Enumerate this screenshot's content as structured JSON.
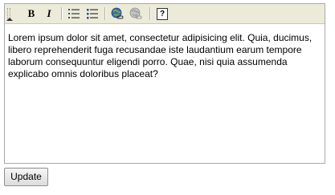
{
  "toolbar": {
    "buttons": [
      {
        "name": "bold",
        "icon": "bold-icon",
        "glyph": "B"
      },
      {
        "name": "italic",
        "icon": "italic-icon",
        "glyph": "I"
      },
      {
        "name": "ordered-list",
        "icon": "ordered-list-icon"
      },
      {
        "name": "unordered-list",
        "icon": "unordered-list-icon"
      },
      {
        "name": "link",
        "icon": "link-globe-icon"
      },
      {
        "name": "unlink",
        "icon": "unlink-globe-icon"
      },
      {
        "name": "help",
        "icon": "help-icon",
        "glyph": "?"
      }
    ],
    "colors": {
      "background": "#ecebd9",
      "separator": "#b5b39e",
      "globe_blue": "#3a6fb0",
      "globe_gray": "#a0a0a0"
    }
  },
  "content": {
    "text": "Lorem ipsum dolor sit amet, consectetur adipisicing elit. Quia, ducimus, libero reprehenderit fuga recusandae iste laudantium earum tempore laborum consequuntur eligendi porro. Quae, nisi quia assumenda explicabo omnis doloribus placeat?"
  },
  "update_button": {
    "label": "Update"
  }
}
